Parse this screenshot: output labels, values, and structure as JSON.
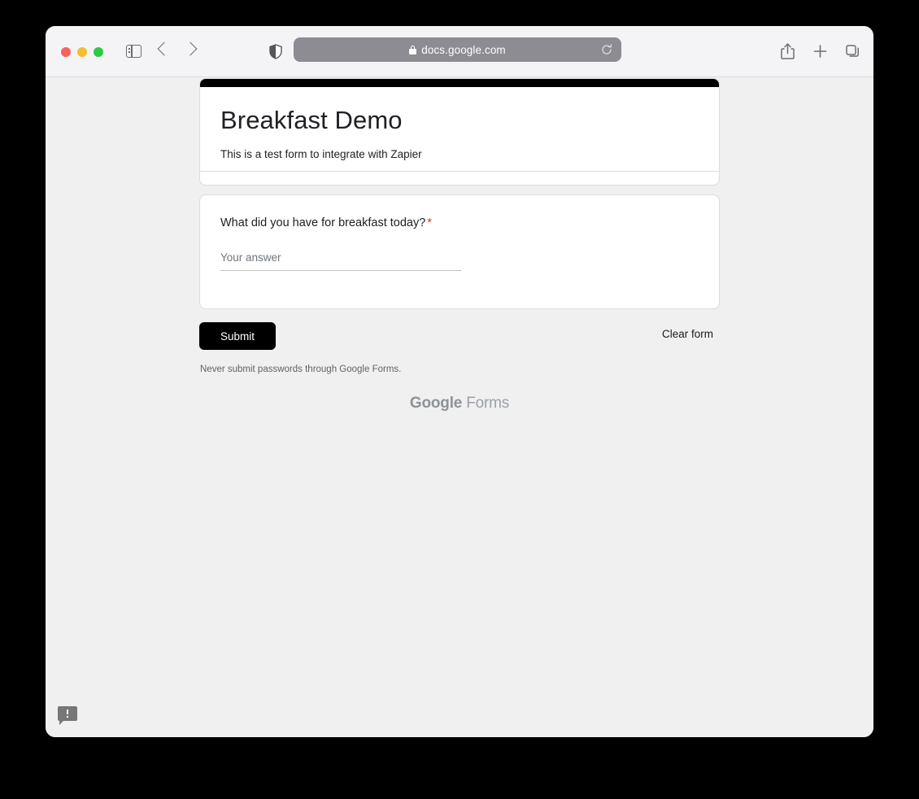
{
  "browser": {
    "window_controls": [
      {
        "name": "close",
        "color": "#f4645a"
      },
      {
        "name": "minimize",
        "color": "#f7bd2e"
      },
      {
        "name": "maximize",
        "color": "#2eca44"
      }
    ],
    "sidebar_toggle_icon": "sidebar-icon",
    "back_icon": "chevron-left-icon",
    "forward_icon": "chevron-right-icon",
    "shield_icon": "shield-icon",
    "address": {
      "lock_icon": "lock-icon",
      "url": "docs.google.com",
      "reload_icon": "reload-icon"
    },
    "right_icons": [
      {
        "name": "share-icon"
      },
      {
        "name": "plus-icon"
      },
      {
        "name": "tab-overview-icon"
      }
    ]
  },
  "form": {
    "accent_color": "#000000",
    "title": "Breakfast Demo",
    "description": "This is a test form to integrate with Zapier",
    "question": {
      "label": "What did you have for breakfast today?",
      "required_marker": "*",
      "answer_value": "",
      "answer_placeholder": "Your answer"
    },
    "submit_label": "Submit",
    "clear_label": "Clear form",
    "disclaimer": "Never submit passwords through Google Forms.",
    "footer": {
      "brand": "Google",
      "product": "Forms"
    }
  },
  "feedback": {
    "icon": "feedback-bubble-icon"
  }
}
